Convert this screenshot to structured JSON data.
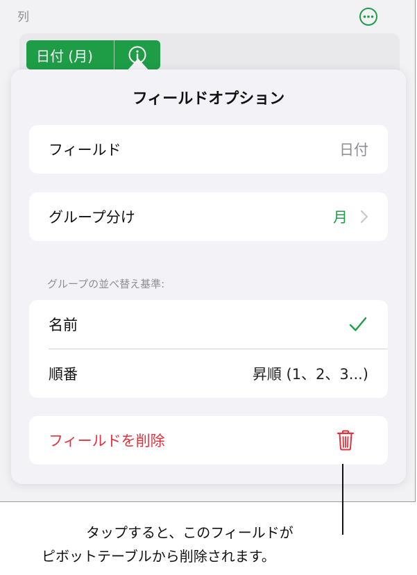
{
  "header": {
    "column_label": "列",
    "more_icon": "ellipsis-circle-icon"
  },
  "field_chip": {
    "label": "日付 (月)",
    "info_icon": "info-circle-icon"
  },
  "popover": {
    "title": "フィールドオプション",
    "field_row": {
      "label": "フィールド",
      "value": "日付"
    },
    "grouping_row": {
      "label": "グループ分け",
      "value": "月"
    },
    "sort_section": {
      "header": "グループの並べ替え基準:",
      "name_row": {
        "label": "名前"
      },
      "order_row": {
        "label": "順番",
        "value": "昇順 (1、2、3...)"
      }
    },
    "delete_row": {
      "label": "フィールドを削除"
    }
  },
  "callout": {
    "line1": "タップすると、このフィールドが",
    "line2": "ピボットテーブルから削除されます。"
  },
  "colors": {
    "accent_green": "#1e9c46",
    "destructive_red": "#e3313b"
  }
}
